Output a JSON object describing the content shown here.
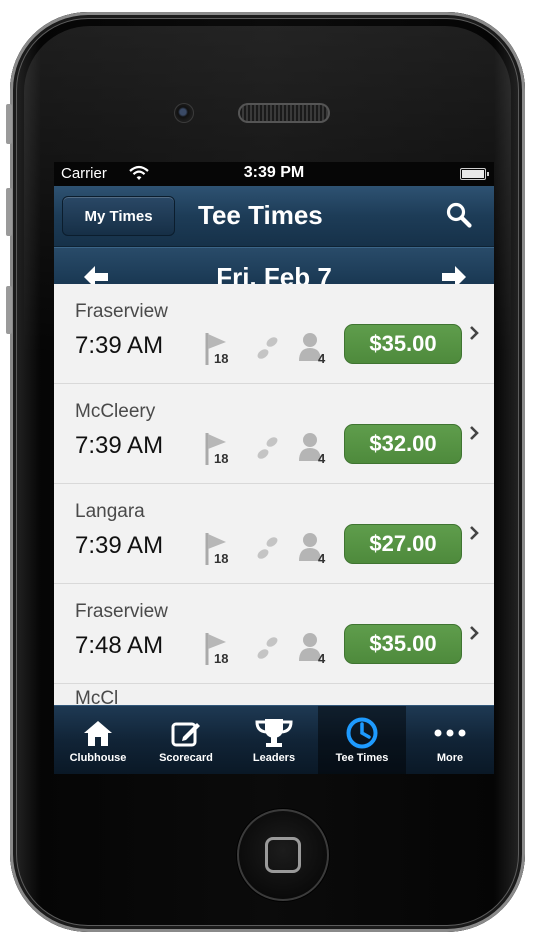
{
  "status_bar": {
    "carrier": "Carrier",
    "time": "3:39 PM"
  },
  "nav_bar": {
    "my_times_label": "My Times",
    "title": "Tee Times"
  },
  "date_bar": {
    "date": "Fri, Feb 7"
  },
  "tee_times": [
    {
      "course": "Fraserview",
      "time": "7:39 AM",
      "holes": "18",
      "players": "4",
      "price": "$35.00"
    },
    {
      "course": "McCleery",
      "time": "7:39 AM",
      "holes": "18",
      "players": "4",
      "price": "$32.00"
    },
    {
      "course": "Langara",
      "time": "7:39 AM",
      "holes": "18",
      "players": "4",
      "price": "$27.00"
    },
    {
      "course": "Fraserview",
      "time": "7:48 AM",
      "holes": "18",
      "players": "4",
      "price": "$35.00"
    }
  ],
  "next_row_peek": "McCl",
  "tab_bar": {
    "tabs": [
      {
        "label": "Clubhouse",
        "icon": "house-icon"
      },
      {
        "label": "Scorecard",
        "icon": "pencil-square-icon"
      },
      {
        "label": "Leaders",
        "icon": "trophy-icon"
      },
      {
        "label": "Tee Times",
        "icon": "clock-icon",
        "active": true
      },
      {
        "label": "More",
        "icon": "ellipsis-icon"
      }
    ]
  },
  "colors": {
    "nav_blue": "#1d3c57",
    "price_green": "#579444",
    "active_tab_icon": "#1e9bff"
  }
}
